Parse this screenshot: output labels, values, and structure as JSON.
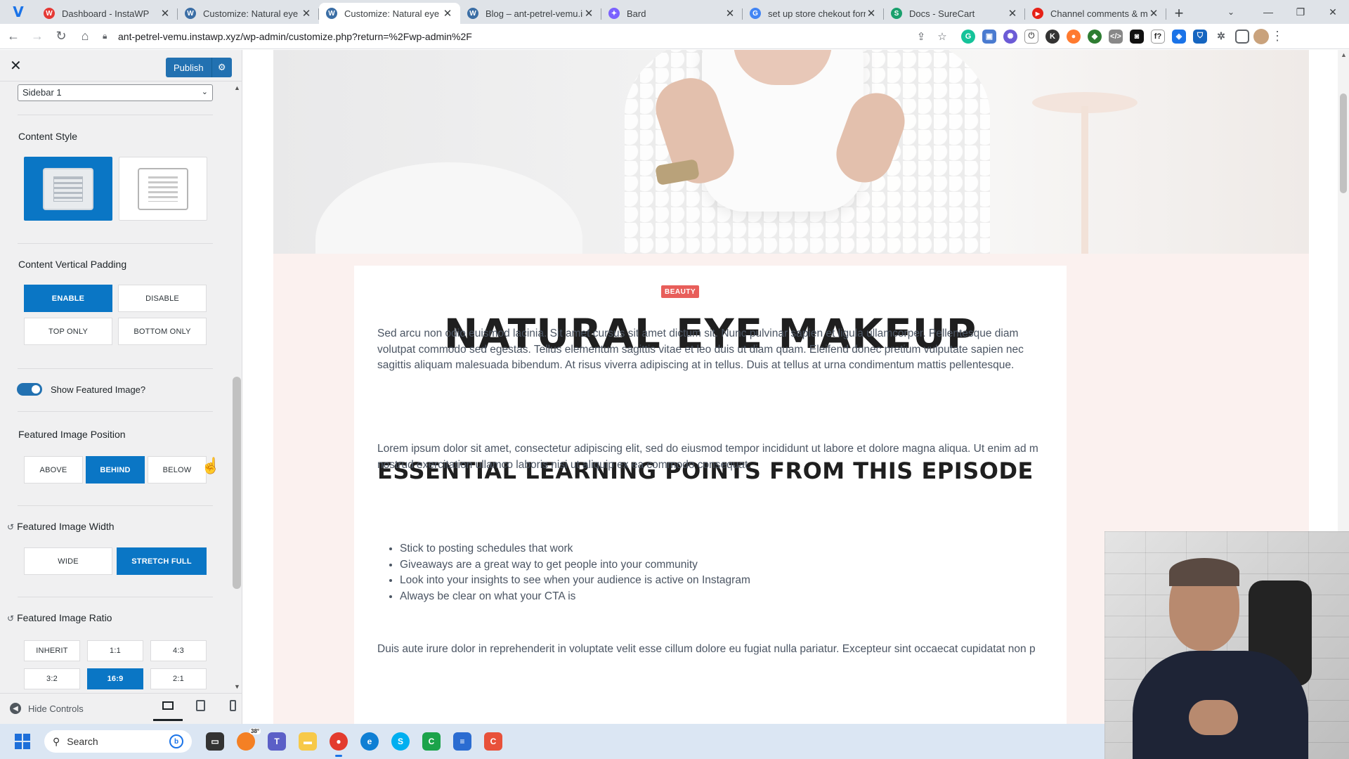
{
  "browser": {
    "tabs": [
      {
        "title": "Dashboard - InstaWP",
        "favicon": "W",
        "color": "#e53935",
        "active": false
      },
      {
        "title": "Customize: Natural eye m",
        "favicon": "W",
        "color": "#3b6ea5",
        "active": false
      },
      {
        "title": "Customize: Natural eye m",
        "favicon": "W",
        "color": "#3b6ea5",
        "active": true
      },
      {
        "title": "Blog – ant-petrel-vemu.in",
        "favicon": "W",
        "color": "#3b6ea5",
        "active": false
      },
      {
        "title": "Bard",
        "favicon": "✦",
        "color": "#7b61ff",
        "active": false
      },
      {
        "title": "set up store chekout form",
        "favicon": "G",
        "color": "#4285f4",
        "active": false
      },
      {
        "title": "Docs - SureCart",
        "favicon": "S",
        "color": "#1aa06d",
        "active": false
      },
      {
        "title": "Channel comments & me",
        "favicon": "▶",
        "color": "#e62117",
        "active": false
      }
    ],
    "url": "ant-petrel-vemu.instawp.xyz/wp-admin/customize.php?return=%2Fwp-admin%2F"
  },
  "customizer": {
    "publish_label": "Publish",
    "sidebar_select": "Sidebar 1",
    "content_style": {
      "title": "Content Style"
    },
    "vertical_padding": {
      "title": "Content Vertical Padding",
      "options": [
        "ENABLE",
        "DISABLE",
        "TOP ONLY",
        "BOTTOM ONLY"
      ],
      "selected": "ENABLE"
    },
    "featured_toggle_label": "Show Featured Image?",
    "image_position": {
      "title": "Featured Image Position",
      "options": [
        "ABOVE",
        "BEHIND",
        "BELOW"
      ],
      "selected": "BEHIND"
    },
    "image_width": {
      "title": "Featured Image Width",
      "options": [
        "WIDE",
        "STRETCH FULL"
      ],
      "selected": "STRETCH FULL"
    },
    "image_ratio": {
      "title": "Featured Image Ratio",
      "options": [
        "INHERIT",
        "1:1",
        "4:3",
        "3:2",
        "16:9",
        "2:1"
      ],
      "selected": "16:9"
    },
    "hide_controls": "Hide Controls"
  },
  "preview": {
    "category": "BEAUTY",
    "title": "NATURAL EYE MAKEUP",
    "intro": "Sed arcu non odio euismod lacinia. Sit amet cursus sit amet dictum sit. Nunc pulvinar sapien et ligula ullamcorper. Pellentesque diam volutpat commodo sed egestas. Tellus elementum sagittis vitae et leo duis ut diam quam. Eleifend donec pretium vulputate sapien nec sagittis aliquam malesuada bibendum. At risus viverra adipiscing at in tellus. Duis at tellus at urna condimentum mattis pellentesque.",
    "heading": "ESSENTIAL LEARNING POINTS FROM THIS EPISODE",
    "para2": "Lorem ipsum dolor sit amet, consectetur adipiscing elit, sed do eiusmod tempor incididunt ut labore et dolore magna aliqua. Ut enim ad m nostrud exercitation ullamco laboris nisi ut aliquip ex ea commodo consequat.",
    "bullets": [
      "Stick to posting schedules that work",
      "Giveaways are a great way to get people into your community",
      "Look into your insights to see when your audience is active on Instagram",
      "Always be clear on what your CTA is"
    ],
    "para3": "Duis aute irure dolor in reprehenderit in voluptate velit esse cillum dolore eu fugiat nulla pariatur. Excepteur sint occaecat cupidatat non p"
  },
  "taskbar": {
    "search_label": "Search",
    "weather_temp": "38°"
  }
}
